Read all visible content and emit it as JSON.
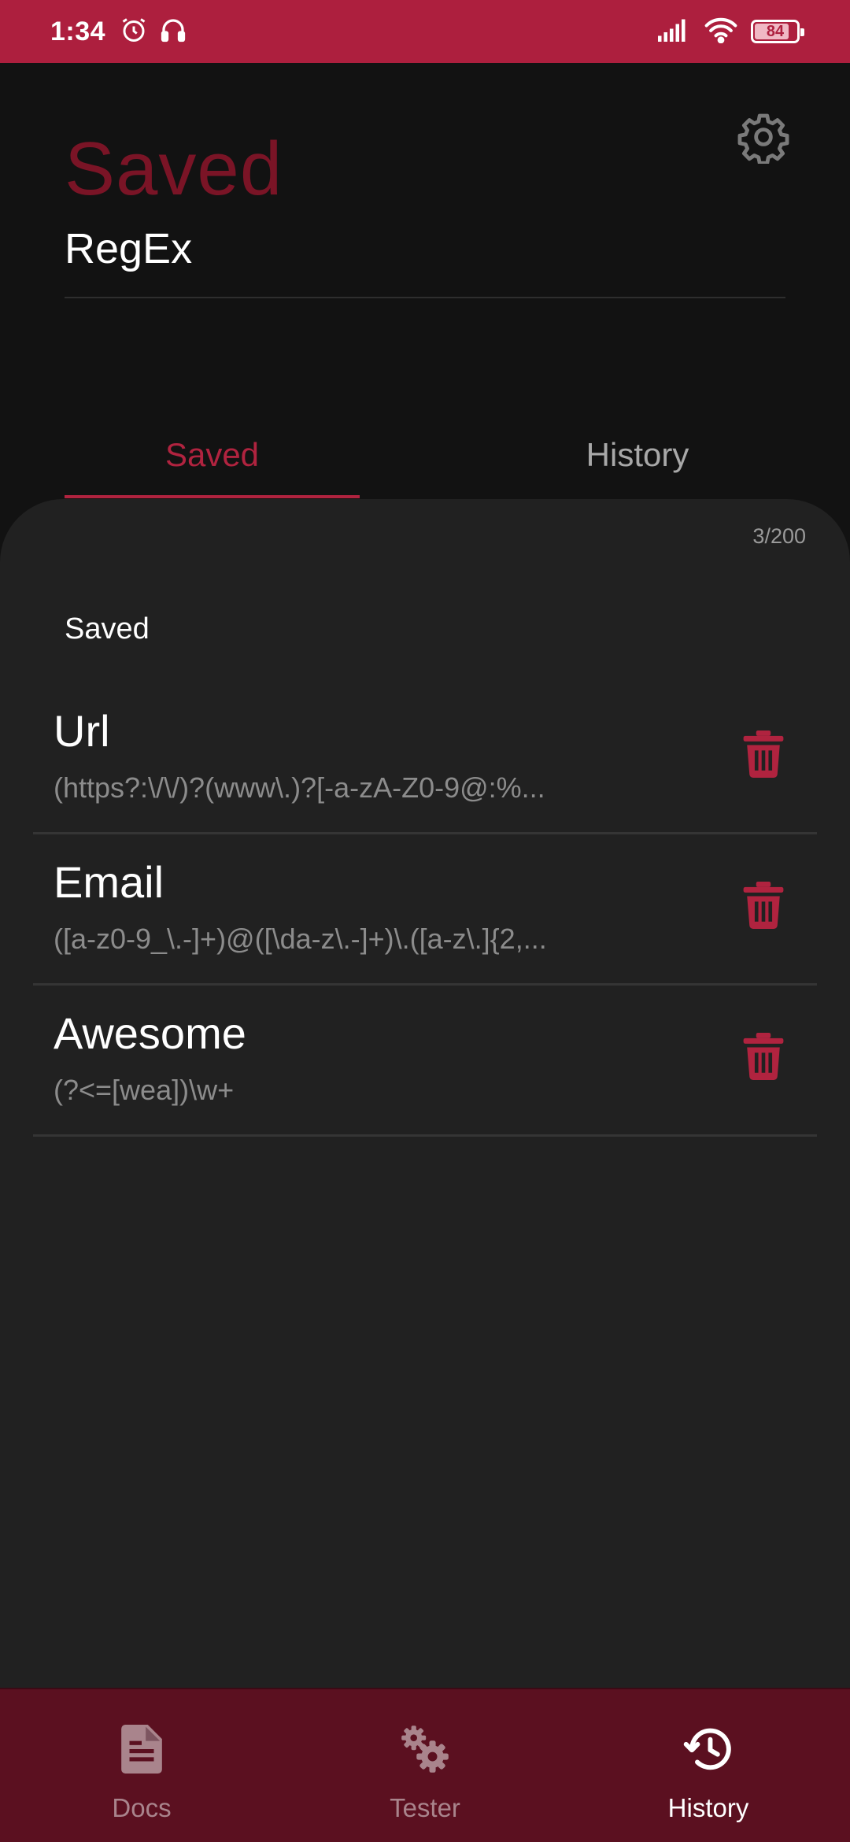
{
  "status_bar": {
    "time": "1:34",
    "battery": "84",
    "battery_level": 0.84,
    "icons": [
      "alarm-icon",
      "headphones-icon",
      "signal-icon",
      "wifi-icon",
      "battery-icon"
    ]
  },
  "header": {
    "title": "Saved",
    "subtitle": "RegEx",
    "settings_icon": "gear-icon"
  },
  "tabs": [
    {
      "label": "Saved",
      "active": true
    },
    {
      "label": "History",
      "active": false
    }
  ],
  "sheet": {
    "counter": "3/200",
    "section_title": "Saved",
    "items": [
      {
        "name": "Url",
        "pattern": "(https?:\\/\\/)?(www\\.)?[-a-zA-Z0-9@:%..."
      },
      {
        "name": "Email",
        "pattern": "([a-z0-9_\\.-]+)@([\\da-z\\.-]+)\\.([a-z\\.]{2,..."
      },
      {
        "name": "Awesome",
        "pattern": "(?<=[wea])\\w+"
      }
    ]
  },
  "bottom_nav": [
    {
      "label": "Docs",
      "icon": "document-icon",
      "active": false
    },
    {
      "label": "Tester",
      "icon": "gears-icon",
      "active": false
    },
    {
      "label": "History",
      "icon": "history-icon",
      "active": true
    }
  ],
  "colors": {
    "accent": "#b0233f",
    "status_bar": "#ad1f3e",
    "nav_background": "#5b1020",
    "sheet_background": "#212121",
    "page_background": "#121212"
  }
}
